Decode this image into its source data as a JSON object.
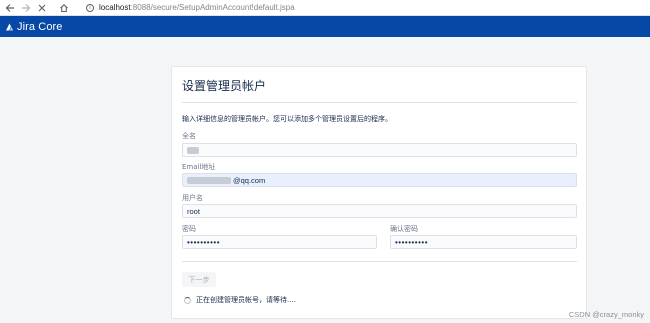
{
  "browser": {
    "url_host": "localhost",
    "url_path": ":8088/secure/SetupAdminAccount!default.jspa"
  },
  "header": {
    "product_name": "Jira Core"
  },
  "setup": {
    "title": "设置管理员帐户",
    "description": "输入详细信息的管理员帐户。您可以添加多个管理员设置后的程序。",
    "fullname_label": "全名",
    "email_label": "Email地址",
    "email_value": "@qq.com",
    "username_label": "用户名",
    "username_value": "root",
    "password_label": "密码",
    "password_value": "••••••••••",
    "confirm_label": "确认密码",
    "confirm_value": "••••••••••",
    "next_label": "下一步",
    "status_text": "正在创建管理员帐号，请等待...."
  },
  "watermark": "CSDN @crazy_monky",
  "colors": {
    "header_bg": "#0747a6",
    "page_bg": "#f4f5f7",
    "autofill_bg": "#e8f0fe"
  }
}
